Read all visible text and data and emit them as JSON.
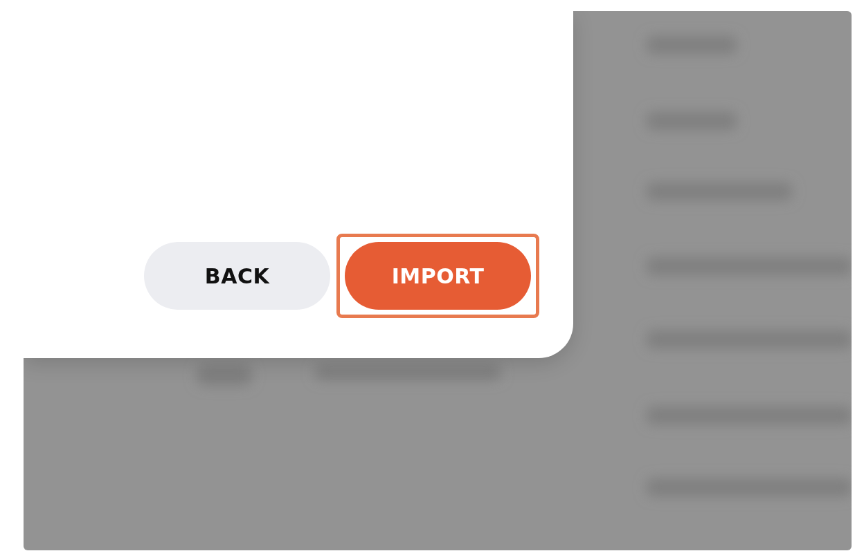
{
  "dialog": {
    "buttons": [
      {
        "label": "BACK",
        "kind": "secondary",
        "highlighted": false
      },
      {
        "label": "IMPORT",
        "kind": "primary",
        "highlighted": true
      }
    ]
  }
}
